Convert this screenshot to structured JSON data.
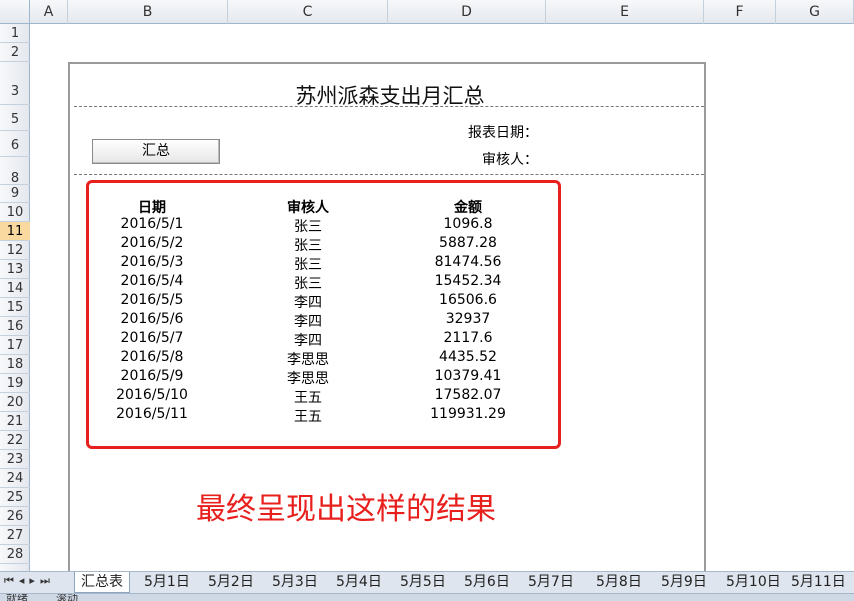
{
  "columns": [
    "A",
    "B",
    "C",
    "D",
    "E",
    "F",
    "G"
  ],
  "rows": [
    "1",
    "2",
    "3",
    "5",
    "6",
    "8",
    "9",
    "10",
    "11",
    "12",
    "13",
    "14",
    "15",
    "16",
    "17",
    "18",
    "19",
    "20",
    "21",
    "22",
    "23",
    "24",
    "25",
    "26",
    "27",
    "28"
  ],
  "active_row": "11",
  "sheet": {
    "title": "苏州派森支出月汇总",
    "button_label": "汇总",
    "report_date_label": "报表日期：",
    "reviewer_label": "审核人：",
    "table": {
      "headers": [
        "日期",
        "审核人",
        "金额"
      ],
      "rows": [
        [
          "2016/5/1",
          "张三",
          "1096.8"
        ],
        [
          "2016/5/2",
          "张三",
          "5887.28"
        ],
        [
          "2016/5/3",
          "张三",
          "81474.56"
        ],
        [
          "2016/5/4",
          "张三",
          "15452.34"
        ],
        [
          "2016/5/5",
          "李四",
          "16506.6"
        ],
        [
          "2016/5/6",
          "李四",
          "32937"
        ],
        [
          "2016/5/7",
          "李四",
          "2117.6"
        ],
        [
          "2016/5/8",
          "李思思",
          "4435.52"
        ],
        [
          "2016/5/9",
          "李思思",
          "10379.41"
        ],
        [
          "2016/5/10",
          "王五",
          "17582.07"
        ],
        [
          "2016/5/11",
          "王五",
          "119931.29"
        ]
      ]
    }
  },
  "annotation": "最终呈现出这样的结果",
  "tabs": [
    "汇总表",
    "5月1日",
    "5月2日",
    "5月3日",
    "5月4日",
    "5月5日",
    "5月6日",
    "5月7日",
    "5月8日",
    "5月9日",
    "5月10日",
    "5月11日"
  ],
  "status": {
    "ready": "就绪",
    "scroll": "滚动"
  },
  "colors": {
    "accent_red": "#e8201d",
    "header_bg": "#e4e8ee",
    "active_row": "#f9d99f"
  }
}
